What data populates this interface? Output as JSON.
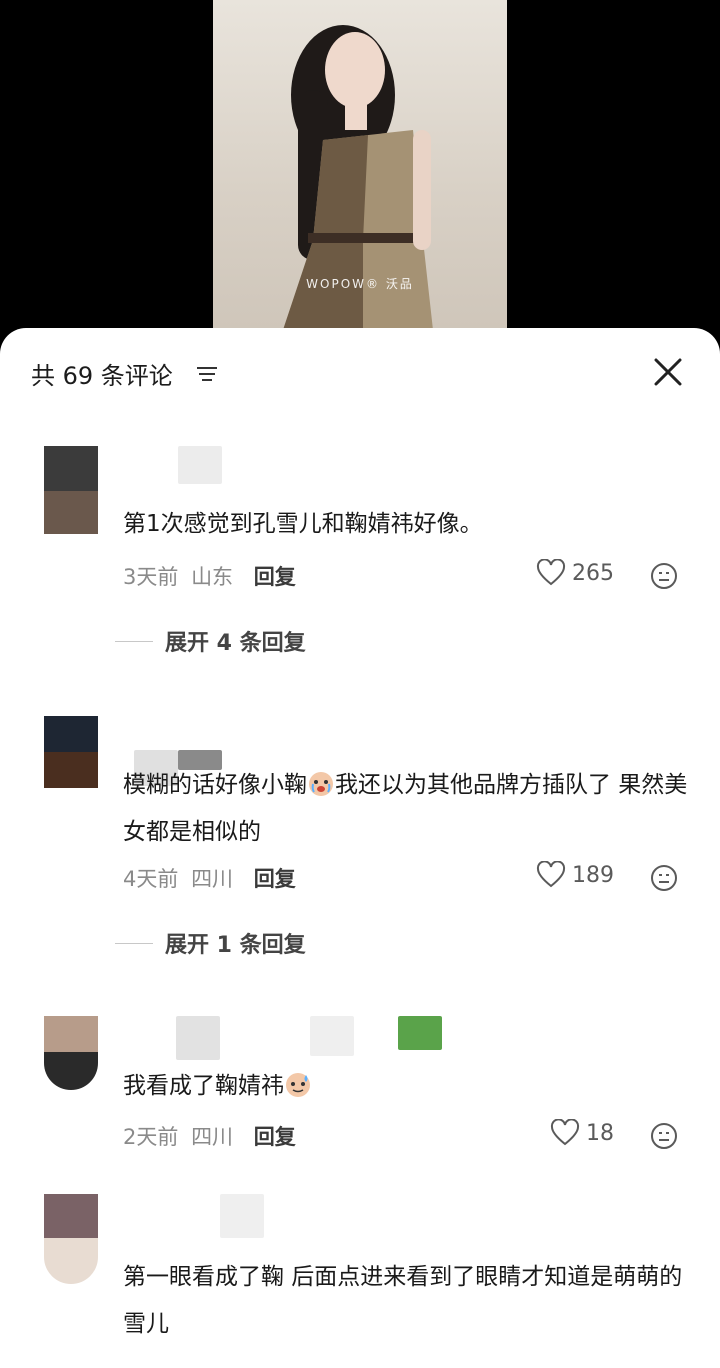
{
  "video": {
    "watermark": "WOPOW® 沃品"
  },
  "panel": {
    "title": "共 69 条评论"
  },
  "comments": [
    {
      "text": "第1次感觉到孔雪儿和鞠婧祎好像。",
      "time": "3天前",
      "location": "山东",
      "reply_label": "回复",
      "likes": "265",
      "expand": "展开 4 条回复"
    },
    {
      "text_before": "模糊的话好像小鞠",
      "text_after": "我还以为其他品牌方插队了 果然美女都是相似的",
      "time": "4天前",
      "location": "四川",
      "reply_label": "回复",
      "likes": "189",
      "expand": "展开 1 条回复"
    },
    {
      "text": "我看成了鞠婧祎",
      "time": "2天前",
      "location": "四川",
      "reply_label": "回复",
      "likes": "18"
    },
    {
      "text": "第一眼看成了鞠 后面点进来看到了眼睛才知道是萌萌的雪儿"
    }
  ]
}
